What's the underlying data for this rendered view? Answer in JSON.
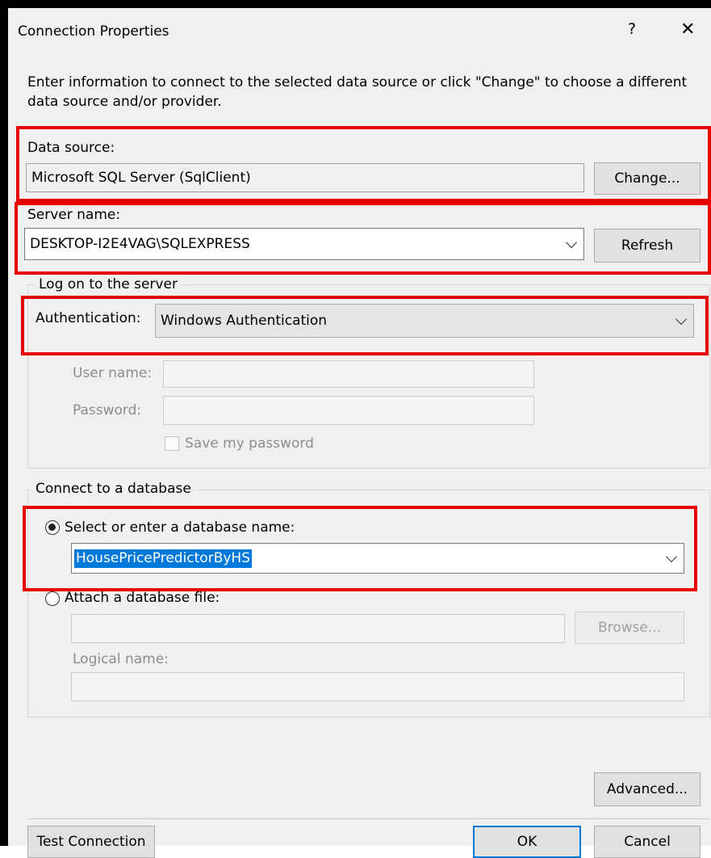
{
  "title": "Connection Properties",
  "title_buttons": {
    "help": "?",
    "close": "✕"
  },
  "instructions": {
    "line1": "Enter information to connect to the selected data source or click \"Change\" to choose a different",
    "line2": "data source and/or provider."
  },
  "data_source": {
    "label": "Data source:",
    "value": "Microsoft SQL Server (SqlClient)",
    "change_button": "Change..."
  },
  "server": {
    "label": "Server name:",
    "value": "DESKTOP-I2E4VAG\\SQLEXPRESS",
    "refresh_button": "Refresh"
  },
  "logon": {
    "group_title": "Log on to the server",
    "auth_label": "Authentication:",
    "auth_value": "Windows Authentication",
    "username_label": "User name:",
    "username_value": "",
    "password_label": "Password:",
    "password_value": "",
    "save_password_label": "Save my password"
  },
  "database": {
    "group_title": "Connect to a database",
    "select_option_label": "Select or enter a database name:",
    "selected_db": "HousePricePredictorByHS",
    "attach_option_label": "Attach a database file:",
    "attach_file_value": "",
    "browse_button": "Browse...",
    "logical_name_label": "Logical name:",
    "logical_name_value": ""
  },
  "buttons": {
    "advanced": "Advanced...",
    "test_connection": "Test Connection",
    "ok": "OK",
    "cancel": "Cancel"
  },
  "colors": {
    "annotation_red": "#e60000",
    "selection_blue": "#0078d7",
    "dialog_bg": "#f0f0f0"
  }
}
